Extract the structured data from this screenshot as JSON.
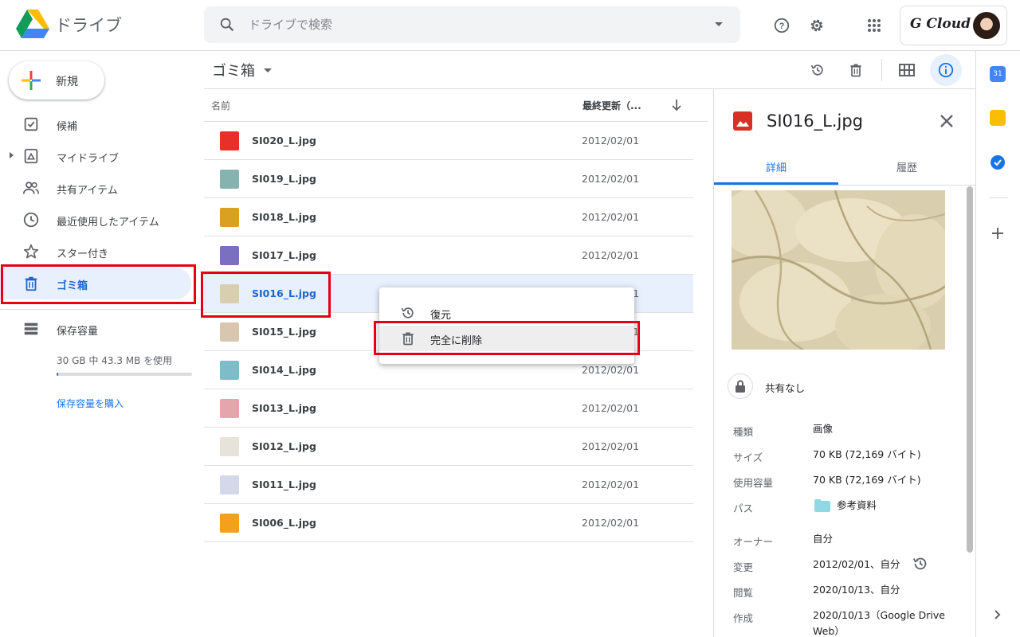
{
  "app": {
    "title": "ドライブ"
  },
  "search": {
    "placeholder": "ドライブで検索"
  },
  "account": {
    "brand": "G Cloud"
  },
  "nav": {
    "new_label": "新規",
    "items": [
      {
        "label": "候補",
        "icon": "check-box-icon"
      },
      {
        "label": "マイドライブ",
        "icon": "my-drive-icon"
      },
      {
        "label": "共有アイテム",
        "icon": "people-icon"
      },
      {
        "label": "最近使用したアイテム",
        "icon": "clock-icon"
      },
      {
        "label": "スター付き",
        "icon": "star-icon"
      },
      {
        "label": "ゴミ箱",
        "icon": "trash-icon",
        "active": true
      }
    ],
    "storage_label": "保存容量",
    "storage_used": "30 GB 中 43.3 MB を使用",
    "storage_fraction": 0.0014,
    "buy_link": "保存容量を購入"
  },
  "toolbar": {
    "breadcrumb": "ゴミ箱"
  },
  "list": {
    "col_name": "名前",
    "col_modified": "最終更新（...",
    "rows": [
      {
        "name": "SI020_L.jpg",
        "date": "2012/02/01",
        "color": "#e8302a"
      },
      {
        "name": "SI019_L.jpg",
        "date": "2012/02/01",
        "color": "#86b3b0"
      },
      {
        "name": "SI018_L.jpg",
        "date": "2012/02/01",
        "color": "#d9a021"
      },
      {
        "name": "SI017_L.jpg",
        "date": "2012/02/01",
        "color": "#7a6fc0"
      },
      {
        "name": "SI016_L.jpg",
        "date": "2012/02/01",
        "color": "#d8cfb0",
        "selected": true
      },
      {
        "name": "SI015_L.jpg",
        "date": "2012/02/01",
        "color": "#d9c6ae"
      },
      {
        "name": "SI014_L.jpg",
        "date": "2012/02/01",
        "color": "#7fbcc9"
      },
      {
        "name": "SI013_L.jpg",
        "date": "2012/02/01",
        "color": "#e6a4ad"
      },
      {
        "name": "SI012_L.jpg",
        "date": "2012/02/01",
        "color": "#e7e2da"
      },
      {
        "name": "SI011_L.jpg",
        "date": "2012/02/01",
        "color": "#d4d8ea"
      },
      {
        "name": "SI006_L.jpg",
        "date": "2012/02/01",
        "color": "#f5a01d"
      }
    ]
  },
  "context_menu": {
    "restore": "復元",
    "delete_forever": "完全に削除"
  },
  "details": {
    "title": "SI016_L.jpg",
    "tab_details": "詳細",
    "tab_history": "履歴",
    "sharing": "共有なし",
    "props": [
      {
        "key": "種類",
        "value": "画像"
      },
      {
        "key": "サイズ",
        "value": "70 KB (72,169 バイト)"
      },
      {
        "key": "使用容量",
        "value": "70 KB (72,169 バイト)"
      },
      {
        "key": "パス",
        "value": "参考資料"
      },
      {
        "key": "オーナー",
        "value": "自分"
      },
      {
        "key": "変更",
        "value": "2012/02/01、自分"
      },
      {
        "key": "閲覧",
        "value": "2020/10/13、自分"
      },
      {
        "key": "作成",
        "value": "2020/10/13（Google Drive Web）"
      }
    ]
  },
  "colors": {
    "accent": "#1a73e8",
    "highlight_box": "#e60012"
  }
}
